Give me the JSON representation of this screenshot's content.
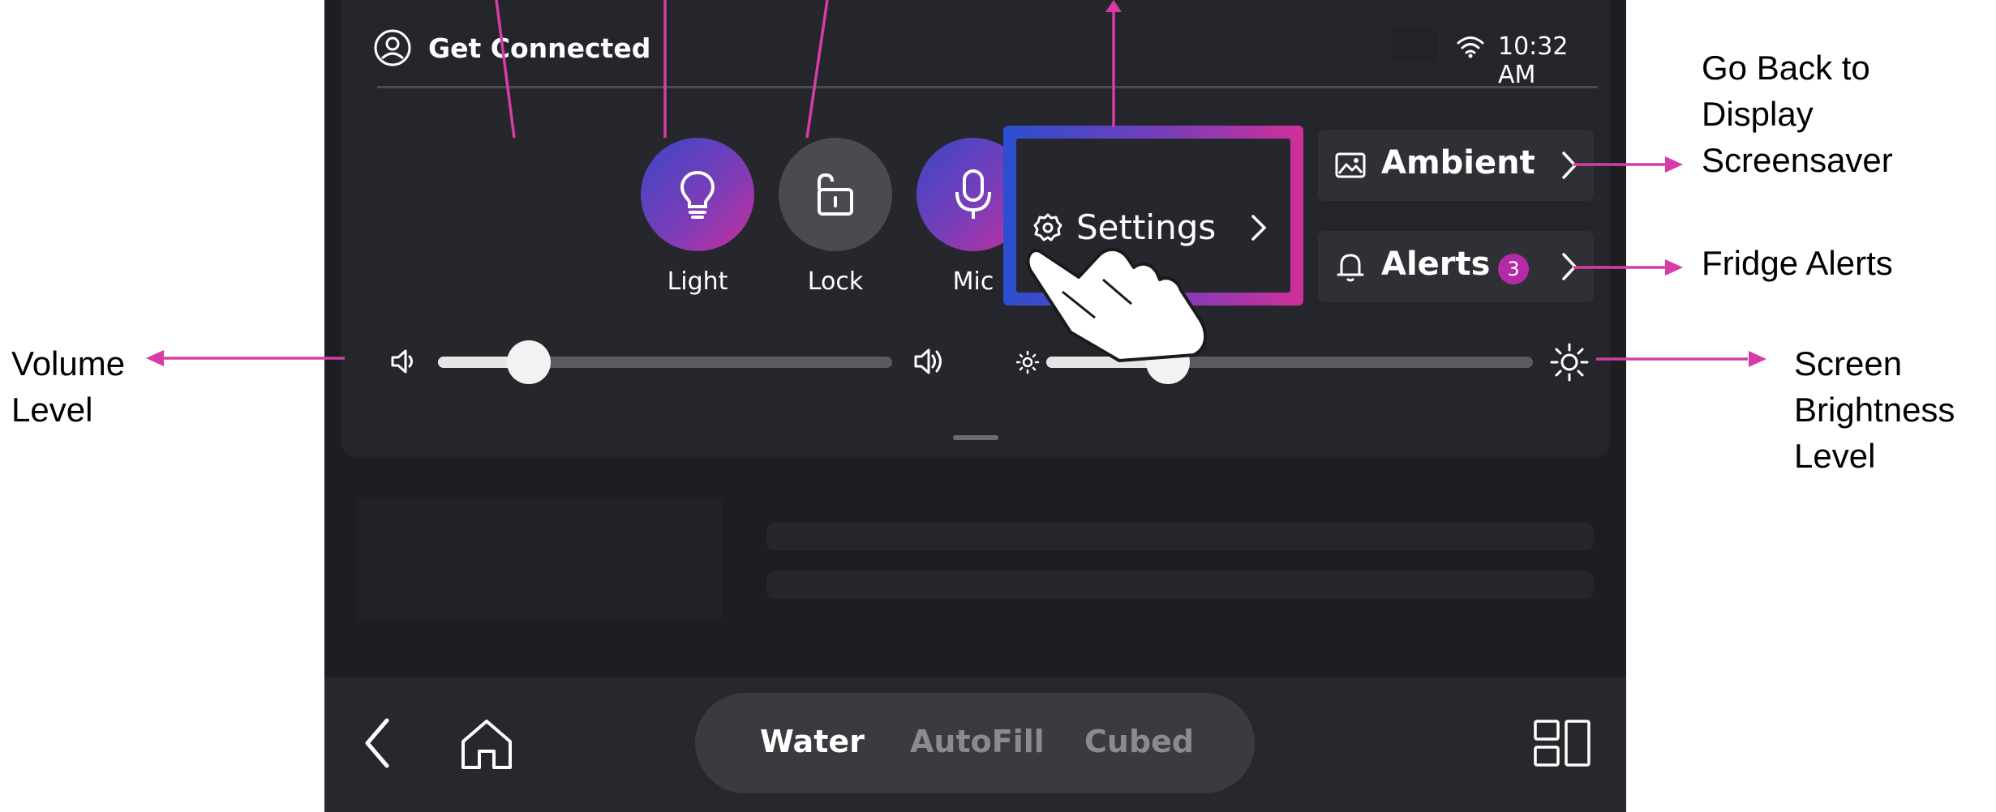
{
  "status_bar": {
    "title": "Get Connected",
    "time": "10:32 AM"
  },
  "quick_buttons": [
    {
      "label": "Light",
      "icon": "lightbulb-icon"
    },
    {
      "label": "Lock",
      "icon": "lock-icon"
    },
    {
      "label": "Mic",
      "icon": "microphone-icon"
    }
  ],
  "volume": {
    "level": 0.2
  },
  "brightness": {
    "level": 0.25
  },
  "settings": {
    "label": "Settings"
  },
  "ambient": {
    "label": "Ambient"
  },
  "alerts": {
    "label": "Alerts",
    "badge": "3"
  },
  "bottom_nav": {
    "tabs": [
      "Water",
      "AutoFill",
      "Cubed"
    ],
    "active_tab": "Water"
  },
  "annotations": {
    "go_back": [
      "Go Back to",
      "Display",
      "Screensaver"
    ],
    "fridge_alerts": "Fridge Alerts",
    "volume": [
      "Volume",
      "Level"
    ],
    "brightness": [
      "Screen",
      "Brightness",
      "Level"
    ]
  },
  "colors": {
    "accent": "#d63ca6",
    "badge": "#b52aa7",
    "background": "#1d1e22",
    "panel": "#25262b"
  }
}
